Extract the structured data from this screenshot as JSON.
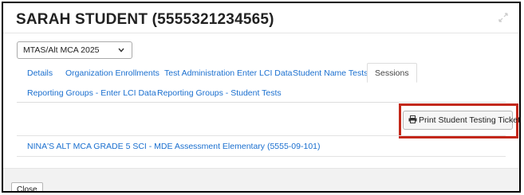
{
  "modal": {
    "title": "SARAH STUDENT (5555321234565)"
  },
  "year_select": {
    "value": "MTAS/Alt MCA 2025"
  },
  "tabs": [
    {
      "label": "Details",
      "active": false
    },
    {
      "label": "Organization Enrollments",
      "active": false
    },
    {
      "label": "Test Administration Enter LCI Data",
      "active": false
    },
    {
      "label": "Student Name Tests",
      "active": false
    },
    {
      "label": "Sessions",
      "active": true
    },
    {
      "label": "Reporting Groups - Enter LCI Data",
      "active": false
    },
    {
      "label": "Reporting Groups - Student Tests",
      "active": false
    }
  ],
  "print_button": {
    "label": "Print Student Testing Tickets",
    "icon": "printer-icon"
  },
  "sessions": [
    {
      "label": "NINA'S ALT MCA GRADE 5 SCI - MDE Assessment Elementary (5555-09-101)"
    }
  ],
  "footer": {
    "close_label": "Close"
  },
  "colors": {
    "link": "#1a6fcf",
    "highlight": "#c3281a"
  }
}
